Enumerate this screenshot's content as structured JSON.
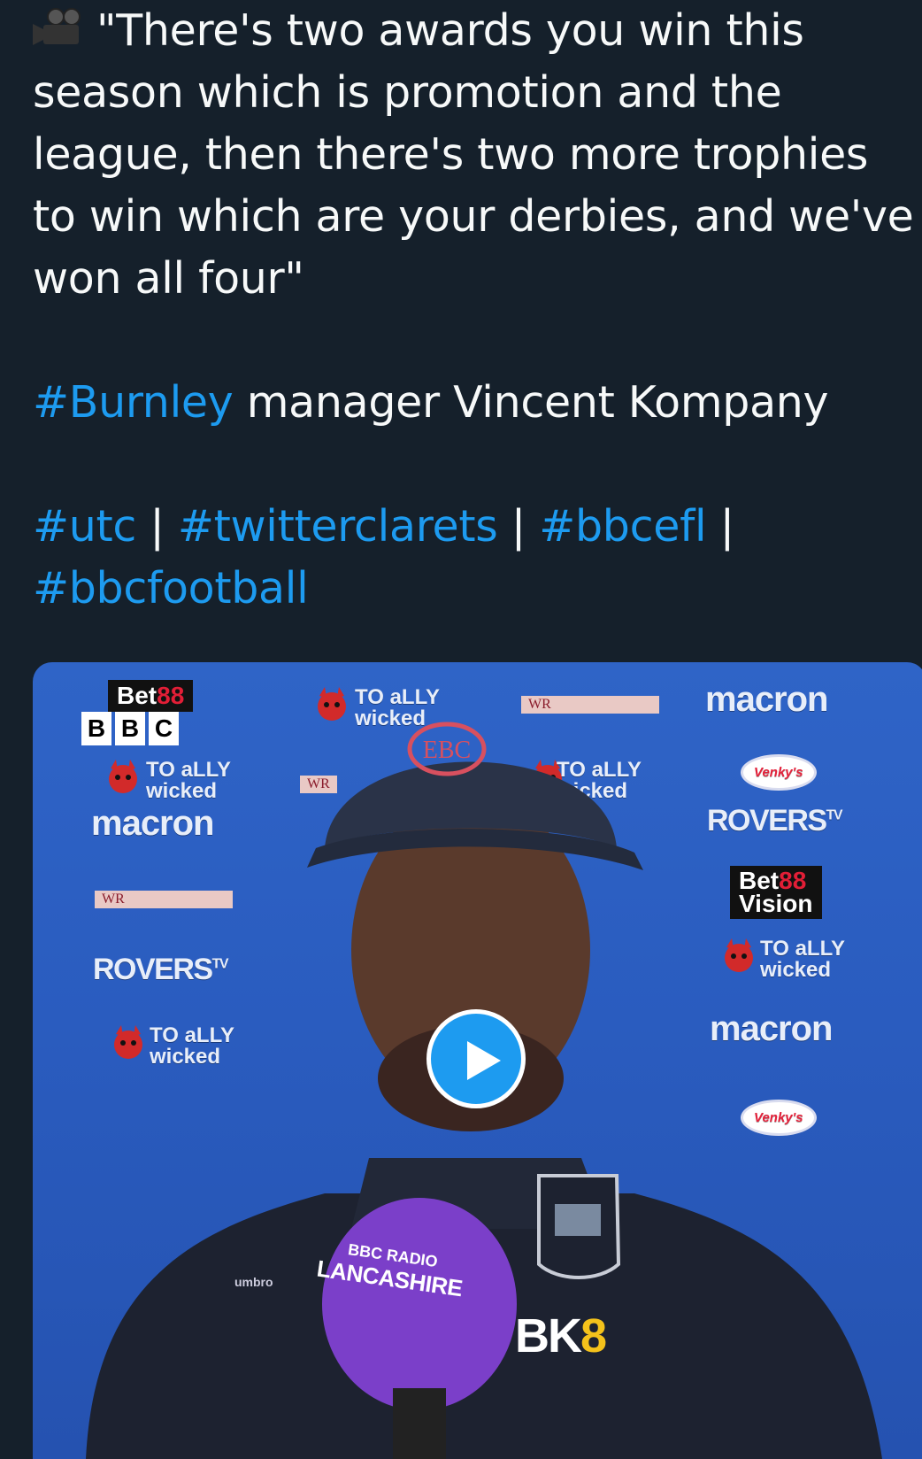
{
  "tweet": {
    "icon": "movie-camera-icon",
    "quote": "\"There's two awards you win this season which is promotion and the league, then there's two more trophies to win which are your derbies, and we've won all four\"",
    "attribution_hashtag": "#Burnley",
    "attribution_text": " manager Vincent Kompany",
    "hashtags": [
      "#utc",
      "#twitterclarets",
      "#bbcefl",
      "#bbcfootball"
    ],
    "separator": " | ",
    "trailing_separator": " |"
  },
  "video": {
    "play_icon": "play-icon",
    "backdrop": {
      "bet88": "Bet",
      "bet88_num": "88",
      "bet88_vision": "Vision",
      "bbc_letters": [
        "B",
        "B",
        "C"
      ],
      "totally_wicked_1": "TO",
      "totally_wicked_2": "aLLY",
      "totally_wicked_3": "wicked",
      "macron": "macron",
      "rovers": "ROVERS",
      "rovers_tv": "TV",
      "venkys": "Venky's",
      "wr": "WR",
      "ebc": "EBC"
    },
    "mic": {
      "radio": "RADIO",
      "bbc": "BBC",
      "station": "LANCASHIRE"
    },
    "kit": {
      "sponsor_a": "BK",
      "sponsor_b": "8",
      "maker": "umbro"
    }
  },
  "colors": {
    "background": "#15202b",
    "text": "#f7f9f9",
    "link": "#1d9bf0",
    "backdrop": "#2f64c7",
    "play_button": "#1d9bf0"
  }
}
